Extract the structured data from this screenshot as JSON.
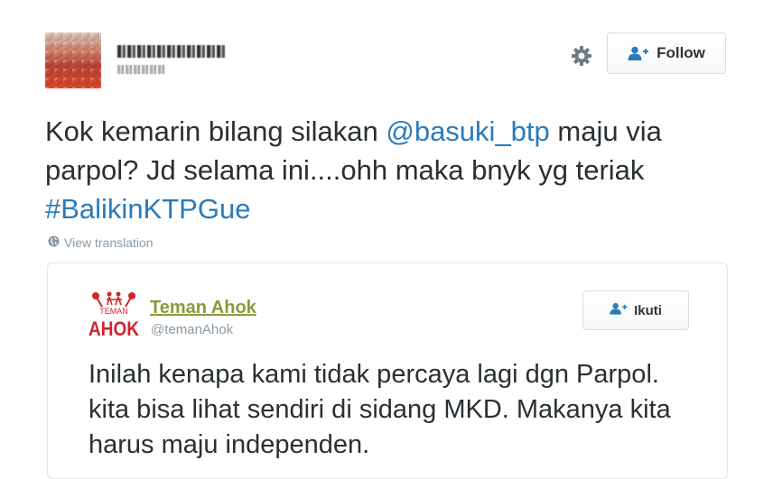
{
  "tweet": {
    "author_name": "█ ███ ██████ █",
    "author_handle": "█████ ██",
    "follow_label": "Follow",
    "text_part1": "Kok kemarin bilang silakan ",
    "mention": "@basuki_btp",
    "text_part2": " maju via parpol? Jd selama ini....ohh maka bnyk yg teriak ",
    "hashtag": "#BalikinKTPGue",
    "translation_label": "View translation"
  },
  "quoted": {
    "logo_small_text": "TEMAN",
    "logo_big_text": "AHOK",
    "name": "Teman Ahok",
    "handle": "@temanAhok",
    "follow_label": "Ikuti",
    "text": "Inilah kenapa kami tidak percaya lagi dgn Parpol. kita bisa lihat sendiri di sidang MKD. Makanya kita harus maju independen."
  },
  "icons": {
    "settings": "gear-icon",
    "follow": "add-user-icon",
    "translate": "globe-icon",
    "logo": "teman-ahok-logo"
  },
  "colors": {
    "link": "#2b7bb9",
    "logo_red": "#d0252d",
    "teman_ahok_name": "#8a9a3c",
    "muted": "#8899a6",
    "follow_icon": "#2b7bb9"
  }
}
